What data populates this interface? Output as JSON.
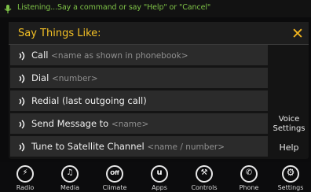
{
  "status": {
    "text": "Listening...Say a command or say \"Help\" or \"Cancel\""
  },
  "panel": {
    "title": "Say Things Like:",
    "close_symbol": "✕",
    "commands": [
      {
        "label": "Call",
        "placeholder": "<name as shown in phonebook>"
      },
      {
        "label": "Dial",
        "placeholder": "<number>"
      },
      {
        "label": "Redial (last outgoing call)",
        "placeholder": ""
      },
      {
        "label": "Send Message to",
        "placeholder": "<name>"
      },
      {
        "label": "Tune to Satellite Channel",
        "placeholder": "<name / number>"
      }
    ],
    "voice_settings": "Voice Settings",
    "help": "Help"
  },
  "nav": [
    {
      "label": "Radio",
      "icon": "radio-icon",
      "glyph": "⚡"
    },
    {
      "label": "Media",
      "icon": "media-icon",
      "glyph": "♫"
    },
    {
      "label": "Climate",
      "icon": "climate-icon",
      "glyph": "Off"
    },
    {
      "label": "Apps",
      "icon": "apps-icon",
      "glyph": "u"
    },
    {
      "label": "Controls",
      "icon": "controls-icon",
      "glyph": "⚒"
    },
    {
      "label": "Phone",
      "icon": "phone-icon",
      "glyph": "✆"
    },
    {
      "label": "Settings",
      "icon": "settings-icon",
      "glyph": "⚙"
    }
  ],
  "colors": {
    "accent": "#f4c126",
    "status_text": "#7ec247",
    "row_bg": "#2b2b2b"
  }
}
